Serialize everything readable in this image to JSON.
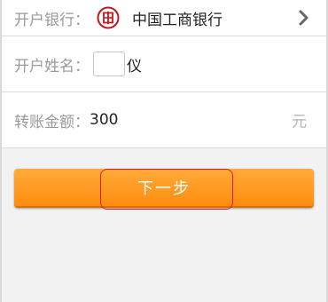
{
  "form": {
    "bank_row": {
      "label": "开户银行：",
      "bank_name": "中国工商银行",
      "logo_icon": "icbc-logo-icon",
      "chevron_icon": "chevron-right-icon"
    },
    "name_row": {
      "label": "开户姓名：",
      "input_value": "",
      "tail_text": "仪"
    },
    "amount_row": {
      "label": "转账金额：",
      "amount": "300",
      "unit": "元"
    }
  },
  "actions": {
    "next_label": "下一步"
  },
  "colors": {
    "button_orange": "#ff9a22",
    "logo_red": "#c4161c",
    "highlight_red": "#d81e1e",
    "label_gray": "#9a9a9a"
  }
}
